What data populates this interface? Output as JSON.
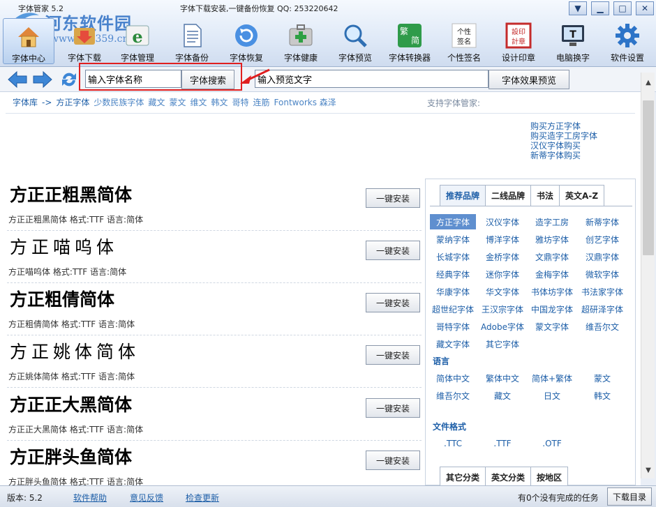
{
  "window": {
    "title": "字体管家 5.2",
    "slogan": "字体下载安装,一键备份恢复 QQ: 253220642",
    "watermark_name": "河东软件园",
    "watermark_url": "www.pc0359.cn"
  },
  "toolbar": [
    {
      "label": "字体中心",
      "icon": "home-icon",
      "active": true
    },
    {
      "label": "字体下载",
      "icon": "download-icon"
    },
    {
      "label": "字体管理",
      "icon": "font-manage-icon"
    },
    {
      "label": "字体备份",
      "icon": "document-icon"
    },
    {
      "label": "字体恢复",
      "icon": "restore-icon"
    },
    {
      "label": "字体健康",
      "icon": "medkit-icon"
    },
    {
      "label": "字体预览",
      "icon": "magnifier-icon"
    },
    {
      "label": "字体转换器",
      "icon": "convert-icon"
    },
    {
      "label": "个性签名",
      "icon": "signature-icon"
    },
    {
      "label": "设计印章",
      "icon": "seal-icon"
    },
    {
      "label": "电脑换字",
      "icon": "monitor-icon"
    },
    {
      "label": "软件设置",
      "icon": "gear-icon"
    }
  ],
  "search": {
    "font_name_value": "输入字体名称",
    "search_button": "字体搜索",
    "preview_value": "输入预览文字",
    "preview_button": "字体效果预览"
  },
  "breadcrumb": [
    "字体库",
    "->",
    "方正字体",
    "少数民族字体",
    "藏文",
    "蒙文",
    "维文",
    "韩文",
    "哥特",
    "连筋",
    "Fontworks 森泽"
  ],
  "support_label": "支持字体管家:",
  "buy_links": [
    "购买方正字体",
    "购买造字工房字体",
    "汉仪字体购买",
    "新蒂字体购买"
  ],
  "fonts": [
    {
      "sample": "方正正粗黑简体",
      "meta": "方正正粗黑简体  格式:TTF 语言:简体",
      "button": "一键安装"
    },
    {
      "sample": "方正喵呜体",
      "meta": "方正喵呜体  格式:TTF 语言:简体",
      "button": "一键安装"
    },
    {
      "sample": "方正粗倩简体",
      "meta": "方正粗倩简体  格式:TTF 语言:简体",
      "button": "一键安装"
    },
    {
      "sample": "方正姚体简体",
      "meta": "方正姚体简体  格式:TTF 语言:简体",
      "button": "一键安装"
    },
    {
      "sample": "方正正大黑简体",
      "meta": "方正正大黑简体  格式:TTF 语言:简体",
      "button": "一键安装"
    },
    {
      "sample": "方正胖头鱼简体",
      "meta": "方正胖头鱼简体  格式:TTF 语言:简体",
      "button": "一键安装"
    }
  ],
  "right_panel": {
    "tabs1": [
      "推荐品牌",
      "二线品牌",
      "书法",
      "英文A-Z"
    ],
    "brands": [
      "方正字体",
      "汉仪字体",
      "造字工房",
      "新蒂字体",
      "蒙纳字体",
      "博洋字体",
      "雅坊字体",
      "创艺字体",
      "长城字体",
      "金桥字体",
      "文鼎字体",
      "汉鼎字体",
      "经典字体",
      "迷你字体",
      "金梅字体",
      "微软字体",
      "华康字体",
      "华文字体",
      "书体坊字体",
      "书法家字体",
      "超世纪字体",
      "王汉宗字体",
      "中国龙字体",
      "超研泽字体",
      "哥特字体",
      "Adobe字体",
      "蒙文字体",
      "维吾尔文",
      "藏文字体",
      "其它字体"
    ],
    "language_label": "语言",
    "languages": [
      "简体中文",
      "繁体中文",
      "简体+繁体",
      "蒙文",
      "维吾尔文",
      "藏文",
      "日文",
      "韩文"
    ],
    "format_label": "文件格式",
    "formats": [
      ".TTC",
      ".TTF",
      ".OTF"
    ],
    "tabs2": [
      "其它分类",
      "英文分类",
      "按地区"
    ]
  },
  "status": {
    "version": "版本: 5.2",
    "links": [
      "软件帮助",
      "意见反馈",
      "检查更新"
    ],
    "tasks": "有0个没有完成的任务",
    "download_dir": "下载目录"
  },
  "colors": {
    "accent": "#1e5fa8",
    "highlight": "#e01f1f",
    "selected_brand": "#5f8fcf"
  }
}
